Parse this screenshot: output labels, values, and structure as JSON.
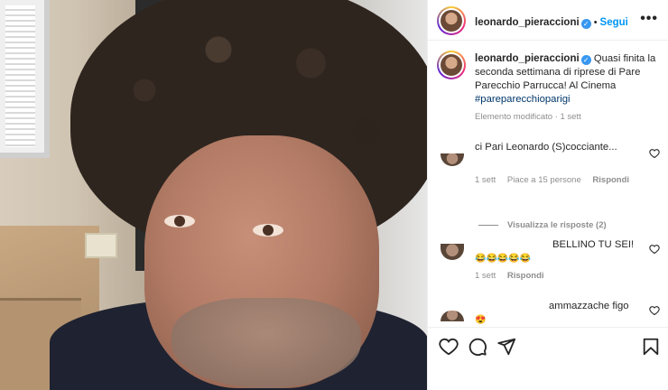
{
  "post": {
    "username": "leonardo_pieraccioni",
    "follow_label": "Segui",
    "more_label": "•••",
    "caption": {
      "text": "Quasi finita la seconda settimana di riprese di Pare Parecchio Parrucca! Al Cinema",
      "hashtag": "#pareparecchioparigi",
      "meta": "Elemento modificato · 1 sett"
    }
  },
  "comments": [
    {
      "text": "ci Pari Leonardo (S)cocciante...",
      "meta_time": "1 sett",
      "meta_likes": "Piace a 15 persone",
      "meta_reply": "Rispondi",
      "view_replies": "Visualizza le risposte (2)"
    },
    {
      "text": "BELLINO TU SEI!",
      "emoji": "😂😂😂😂😂",
      "meta_time": "1 sett",
      "meta_reply": "Rispondi"
    },
    {
      "text": "ammazzache figo",
      "emoji": "😍"
    }
  ],
  "actions": {
    "like": "heart-icon",
    "comment": "comment-icon",
    "share": "send-icon",
    "save": "bookmark-icon"
  },
  "colors": {
    "link_blue": "#0095f6",
    "hashtag": "#00376b",
    "meta_gray": "#8e8e8e",
    "verified_blue": "#3897f0"
  }
}
